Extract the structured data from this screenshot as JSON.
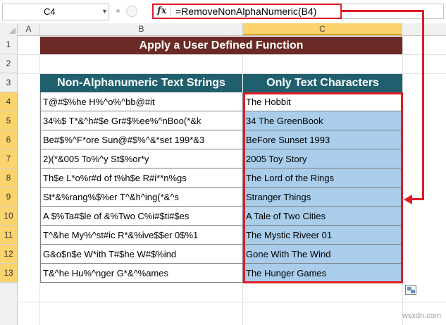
{
  "name_box": {
    "value": "C4"
  },
  "formula_bar": {
    "fx_label": "fx",
    "formula": "=RemoveNonAlphaNumeric(B4)"
  },
  "columns": [
    "A",
    "B",
    "C"
  ],
  "rows": [
    "1",
    "2",
    "3",
    "4",
    "5",
    "6",
    "7",
    "8",
    "9",
    "10",
    "11",
    "12",
    "13"
  ],
  "title": "Apply a User Defined Function",
  "table": {
    "headers": [
      "Non-Alphanumeric Text Strings",
      "Only Text Characters"
    ],
    "rows": [
      [
        "T@#$%he H%^o%^bb@#it",
        "The Hobbit"
      ],
      [
        "34%$ T*&^h#$e Gr#$%ee%^nBoo(*&k",
        "34 The GreenBook"
      ],
      [
        "Be#$%^F*ore Sun@#$%^&*set 199*&3",
        "BeFore Sunset 1993"
      ],
      [
        "2)(*&005 To%^y St$%or*y",
        "2005 Toy Story"
      ],
      [
        "Th$e L*o%r#d of t%h$e R#i**n%gs",
        "The Lord of the Rings"
      ],
      [
        "St*&%rang%$%er T^&h^ing(*&^s",
        "Stranger Things"
      ],
      [
        "A $%Ta#$le of &%Two C%i#$ti#$es",
        "A Tale of Two Cities"
      ],
      [
        "T^&he My%^st#ic R*&%ive$$er 0$%1",
        "The Mystic Riveer 01"
      ],
      [
        "G&o$n$e W*ith T#$he W#$%ind",
        "Gone With The Wind"
      ],
      [
        "T&^he Hu%^nger G*&^%ames",
        "The Hunger Games"
      ]
    ]
  },
  "watermark": "wsxdn.com",
  "colors": {
    "title_bg": "#6b2a25",
    "header_bg": "#20606e",
    "result_fill": "#a9cdeb",
    "highlight": "#e01b24",
    "selected_header": "#fbd46d"
  }
}
